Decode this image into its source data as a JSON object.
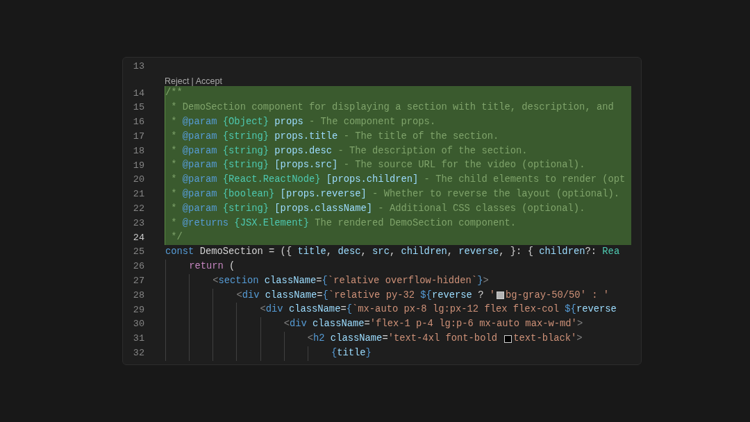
{
  "editor": {
    "before": [
      {
        "number": "13",
        "current": false,
        "added": false
      }
    ],
    "code_lens": {
      "actions": [
        {
          "label": "Reject"
        },
        {
          "label": "Accept"
        }
      ],
      "separator": "|"
    },
    "lines": [
      {
        "number": "14",
        "current": false,
        "added": true,
        "tokens": [
          {
            "kind": "comment",
            "text": "/**"
          }
        ]
      },
      {
        "number": "15",
        "current": false,
        "added": true,
        "tokens": [
          {
            "kind": "comment",
            "text": " * DemoSection component for displaying a section with title, description, and"
          }
        ]
      },
      {
        "number": "16",
        "current": false,
        "added": true,
        "tokens": [
          {
            "kind": "comment",
            "text": " * "
          },
          {
            "kind": "doctag",
            "text": "@param"
          },
          {
            "kind": "type",
            "text": " {Object}"
          },
          {
            "kind": "param",
            "text": " props"
          },
          {
            "kind": "comment",
            "text": " - The component props."
          }
        ]
      },
      {
        "number": "17",
        "current": false,
        "added": true,
        "tokens": [
          {
            "kind": "comment",
            "text": " * "
          },
          {
            "kind": "doctag",
            "text": "@param"
          },
          {
            "kind": "type",
            "text": " {string}"
          },
          {
            "kind": "param",
            "text": " props.title"
          },
          {
            "kind": "comment",
            "text": " - The title of the section."
          }
        ]
      },
      {
        "number": "18",
        "current": false,
        "added": true,
        "tokens": [
          {
            "kind": "comment",
            "text": " * "
          },
          {
            "kind": "doctag",
            "text": "@param"
          },
          {
            "kind": "type",
            "text": " {string}"
          },
          {
            "kind": "param",
            "text": " props.desc"
          },
          {
            "kind": "comment",
            "text": " - The description of the section."
          }
        ]
      },
      {
        "number": "19",
        "current": false,
        "added": true,
        "tokens": [
          {
            "kind": "comment",
            "text": " * "
          },
          {
            "kind": "doctag",
            "text": "@param"
          },
          {
            "kind": "type",
            "text": " {string}"
          },
          {
            "kind": "param",
            "text": " [props.src]"
          },
          {
            "kind": "comment",
            "text": " - The source URL for the video (optional)."
          }
        ]
      },
      {
        "number": "20",
        "current": false,
        "added": true,
        "tokens": [
          {
            "kind": "comment",
            "text": " * "
          },
          {
            "kind": "doctag",
            "text": "@param"
          },
          {
            "kind": "type",
            "text": " {React.ReactNode}"
          },
          {
            "kind": "param",
            "text": " [props.children]"
          },
          {
            "kind": "comment",
            "text": " - The child elements to render (opt"
          }
        ]
      },
      {
        "number": "21",
        "current": false,
        "added": true,
        "tokens": [
          {
            "kind": "comment",
            "text": " * "
          },
          {
            "kind": "doctag",
            "text": "@param"
          },
          {
            "kind": "type",
            "text": " {boolean}"
          },
          {
            "kind": "param",
            "text": " [props.reverse]"
          },
          {
            "kind": "comment",
            "text": " - Whether to reverse the layout (optional)."
          }
        ]
      },
      {
        "number": "22",
        "current": false,
        "added": true,
        "tokens": [
          {
            "kind": "comment",
            "text": " * "
          },
          {
            "kind": "doctag",
            "text": "@param"
          },
          {
            "kind": "type",
            "text": " {string}"
          },
          {
            "kind": "param",
            "text": " [props.className]"
          },
          {
            "kind": "comment",
            "text": " - Additional CSS classes (optional)."
          }
        ]
      },
      {
        "number": "23",
        "current": false,
        "added": true,
        "tokens": [
          {
            "kind": "comment",
            "text": " * "
          },
          {
            "kind": "doctag",
            "text": "@returns"
          },
          {
            "kind": "type",
            "text": " {JSX.Element}"
          },
          {
            "kind": "comment",
            "text": " The rendered DemoSection component."
          }
        ]
      },
      {
        "number": "24",
        "current": true,
        "added": true,
        "tokens": [
          {
            "kind": "comment",
            "text": " */"
          }
        ]
      },
      {
        "number": "25",
        "current": false,
        "added": false,
        "tokens": [
          {
            "kind": "keyword",
            "text": "const"
          },
          {
            "kind": "plain",
            "text": " DemoSection = ({ "
          },
          {
            "kind": "var",
            "text": "title"
          },
          {
            "kind": "plain",
            "text": ", "
          },
          {
            "kind": "var",
            "text": "desc"
          },
          {
            "kind": "plain",
            "text": ", "
          },
          {
            "kind": "var",
            "text": "src"
          },
          {
            "kind": "plain",
            "text": ", "
          },
          {
            "kind": "var",
            "text": "children"
          },
          {
            "kind": "plain",
            "text": ", "
          },
          {
            "kind": "var",
            "text": "reverse"
          },
          {
            "kind": "plain",
            "text": ", }: { "
          },
          {
            "kind": "var",
            "text": "children"
          },
          {
            "kind": "plain",
            "text": "?: "
          },
          {
            "kind": "type",
            "text": "Rea"
          }
        ]
      },
      {
        "number": "26",
        "current": false,
        "added": false,
        "tokens": [
          {
            "kind": "control",
            "text": "    return"
          },
          {
            "kind": "plain",
            "text": " ("
          }
        ]
      },
      {
        "number": "27",
        "current": false,
        "added": false,
        "tokens": [
          {
            "kind": "punct",
            "text": "        <"
          },
          {
            "kind": "element",
            "text": "section"
          },
          {
            "kind": "var",
            "text": " className"
          },
          {
            "kind": "plain",
            "text": "="
          },
          {
            "kind": "keyword",
            "text": "{"
          },
          {
            "kind": "string",
            "text": "`relative overflow-hidden`"
          },
          {
            "kind": "keyword",
            "text": "}"
          },
          {
            "kind": "punct",
            "text": ">"
          }
        ]
      },
      {
        "number": "28",
        "current": false,
        "added": false,
        "tokens": [
          {
            "kind": "punct",
            "text": "            <"
          },
          {
            "kind": "element",
            "text": "div"
          },
          {
            "kind": "var",
            "text": " className"
          },
          {
            "kind": "plain",
            "text": "="
          },
          {
            "kind": "keyword",
            "text": "{"
          },
          {
            "kind": "string",
            "text": "`relative py-32 "
          },
          {
            "kind": "keyword",
            "text": "${"
          },
          {
            "kind": "var",
            "text": "reverse"
          },
          {
            "kind": "plain",
            "text": " ? "
          },
          {
            "kind": "string",
            "text": "'"
          },
          {
            "kind": "swatch",
            "color": "#b4b4b4"
          },
          {
            "kind": "string",
            "text": "bg-gray-50/50' : '"
          }
        ]
      },
      {
        "number": "29",
        "current": false,
        "added": false,
        "tokens": [
          {
            "kind": "punct",
            "text": "                <"
          },
          {
            "kind": "element",
            "text": "div"
          },
          {
            "kind": "var",
            "text": " className"
          },
          {
            "kind": "plain",
            "text": "="
          },
          {
            "kind": "keyword",
            "text": "{"
          },
          {
            "kind": "string",
            "text": "`mx-auto px-8 lg:px-12 flex flex-col "
          },
          {
            "kind": "keyword",
            "text": "${"
          },
          {
            "kind": "var",
            "text": "reverse"
          }
        ]
      },
      {
        "number": "30",
        "current": false,
        "added": false,
        "tokens": [
          {
            "kind": "punct",
            "text": "                    <"
          },
          {
            "kind": "element",
            "text": "div"
          },
          {
            "kind": "var",
            "text": " className"
          },
          {
            "kind": "plain",
            "text": "="
          },
          {
            "kind": "string",
            "text": "'flex-1 p-4 lg:p-6 mx-auto max-w-md'"
          },
          {
            "kind": "punct",
            "text": ">"
          }
        ]
      },
      {
        "number": "31",
        "current": false,
        "added": false,
        "tokens": [
          {
            "kind": "punct",
            "text": "                        <"
          },
          {
            "kind": "element",
            "text": "h2"
          },
          {
            "kind": "var",
            "text": " className"
          },
          {
            "kind": "plain",
            "text": "="
          },
          {
            "kind": "string",
            "text": "'text-4xl font-bold "
          },
          {
            "kind": "swatch",
            "color": "#000000"
          },
          {
            "kind": "string",
            "text": "text-black'"
          },
          {
            "kind": "punct",
            "text": ">"
          }
        ]
      },
      {
        "number": "32",
        "current": false,
        "added": false,
        "tokens": [
          {
            "kind": "keyword",
            "text": "                            {"
          },
          {
            "kind": "var",
            "text": "title"
          },
          {
            "kind": "keyword",
            "text": "}"
          }
        ]
      }
    ]
  }
}
